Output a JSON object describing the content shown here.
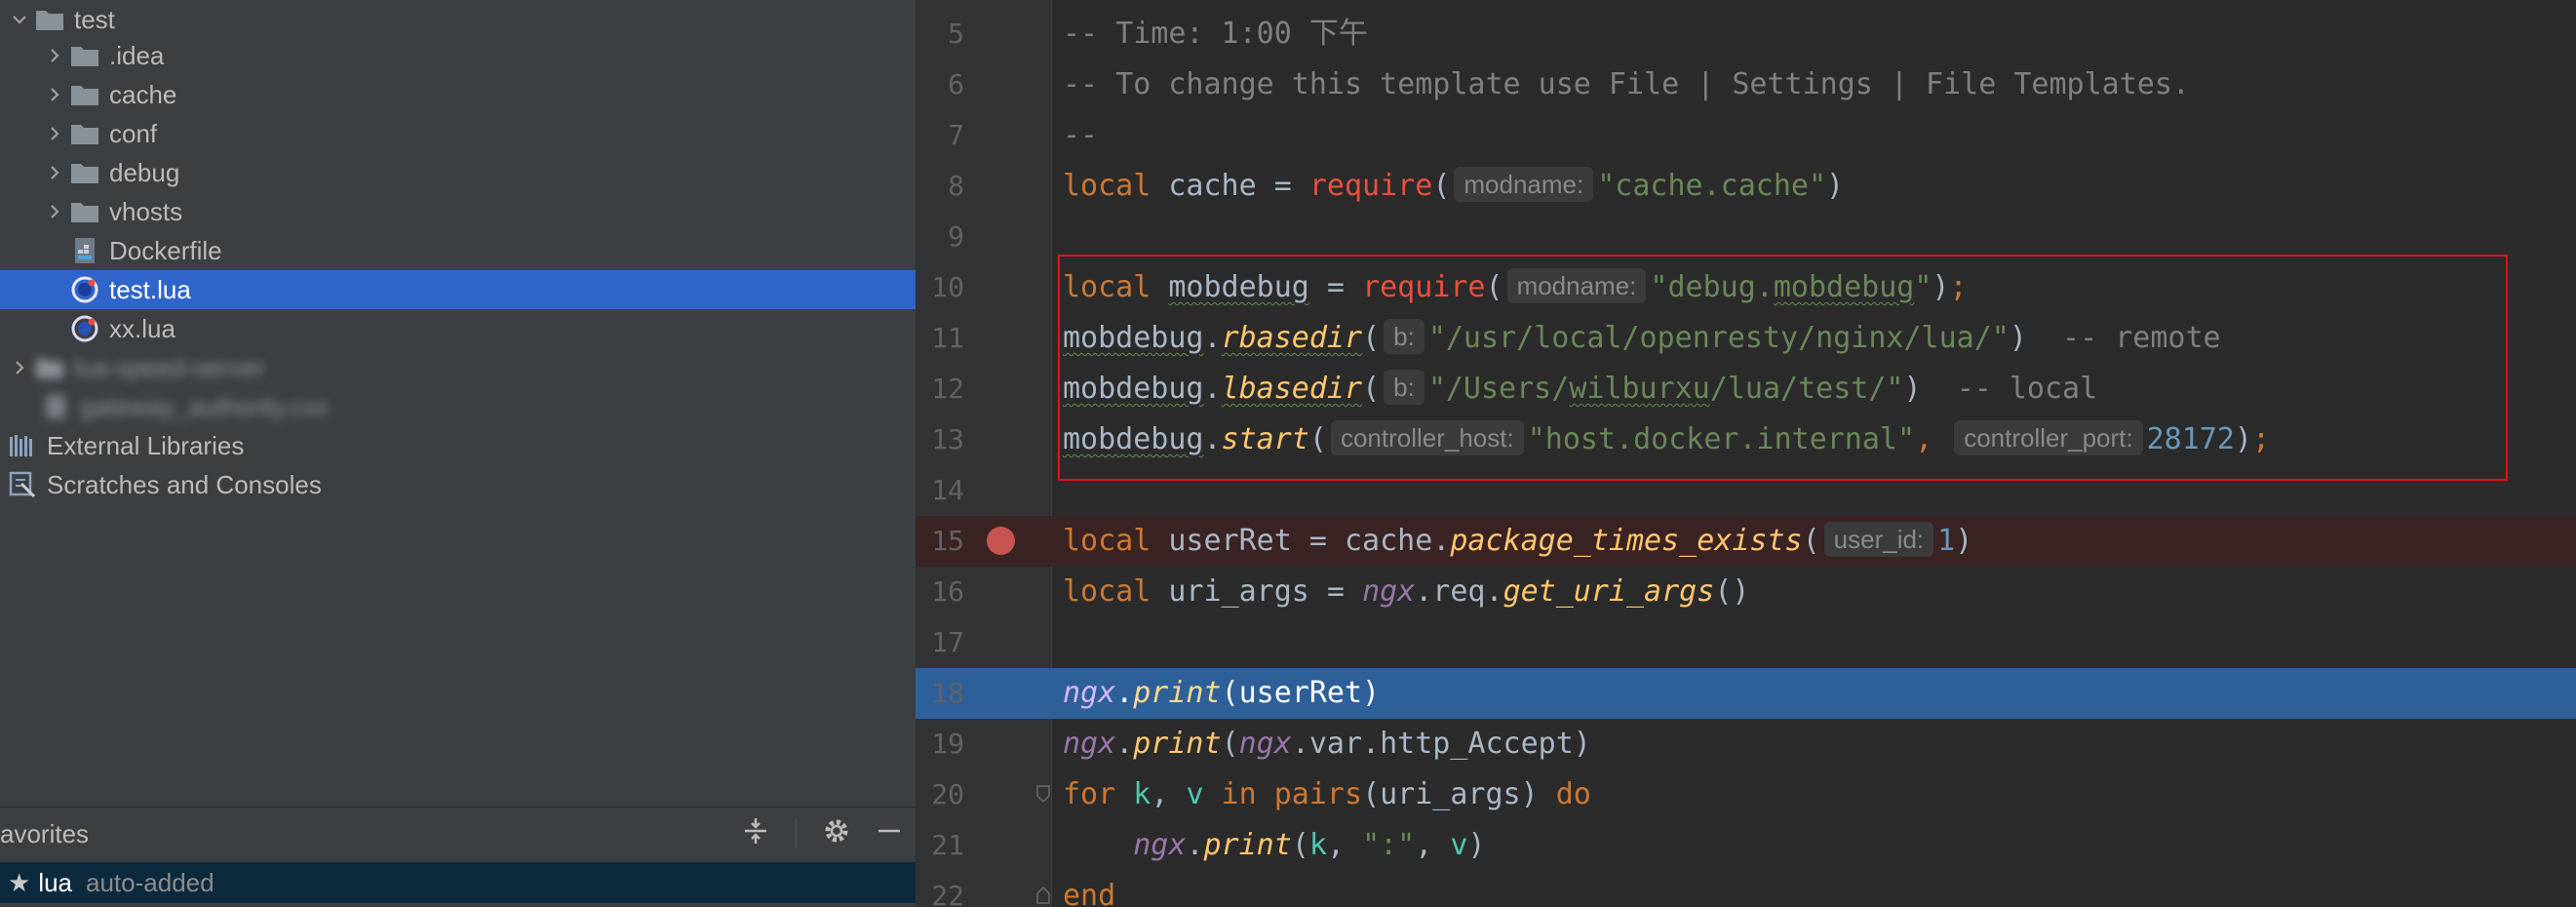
{
  "tree": {
    "root": "test",
    "items": [
      {
        "label": ".idea",
        "type": "folder"
      },
      {
        "label": "cache",
        "type": "folder"
      },
      {
        "label": "conf",
        "type": "folder"
      },
      {
        "label": "debug",
        "type": "folder"
      },
      {
        "label": "vhosts",
        "type": "folder"
      },
      {
        "label": "Dockerfile",
        "type": "docker"
      },
      {
        "label": "test.lua",
        "type": "lua",
        "selected": true
      },
      {
        "label": "xx.lua",
        "type": "lua"
      }
    ],
    "blurred_1": "lua-speed-server",
    "blurred_2": "gateway_authority.cxx",
    "external_libraries": "External Libraries",
    "scratches": "Scratches and Consoles"
  },
  "favorites": {
    "title": "avorites",
    "item_name": "lua",
    "item_hint": "auto-added"
  },
  "editor": {
    "line_numbers": [
      "5",
      "6",
      "7",
      "8",
      "9",
      "10",
      "11",
      "12",
      "13",
      "14",
      "15",
      "16",
      "17",
      "18",
      "19",
      "20",
      "21",
      "22"
    ],
    "comment_time": "-- Time: 1:00 下午",
    "comment_template": "-- To change this template use File | Settings | File Templates.",
    "comment_dash": "--",
    "hints": {
      "modname": "modname:",
      "b": "b:",
      "controller_host": "controller_host:",
      "controller_port": "controller_port:",
      "user_id": "user_id:"
    },
    "strings": {
      "cache_cache": "\"cache.cache\"",
      "debug_mobdebug_pre": "\"debug.",
      "debug_mobdebug_word": "mobdebug",
      "debug_mobdebug_post": "\"",
      "rbasedir": "\"/usr/local/openresty/nginx/lua/\"",
      "lbasedir_pre": "\"/Users/",
      "lbasedir_user": "wilburxu",
      "lbasedir_post": "/lua/test/\"",
      "host": "\"host.docker.internal\"",
      "colon": "\":\""
    },
    "numbers": {
      "port": "28172",
      "user_id": "1"
    },
    "comments": {
      "remote": "-- remote",
      "local": "-- local"
    },
    "highlight_color": "#e0121c",
    "breakpoint_line": "15",
    "execution_line": "18"
  }
}
